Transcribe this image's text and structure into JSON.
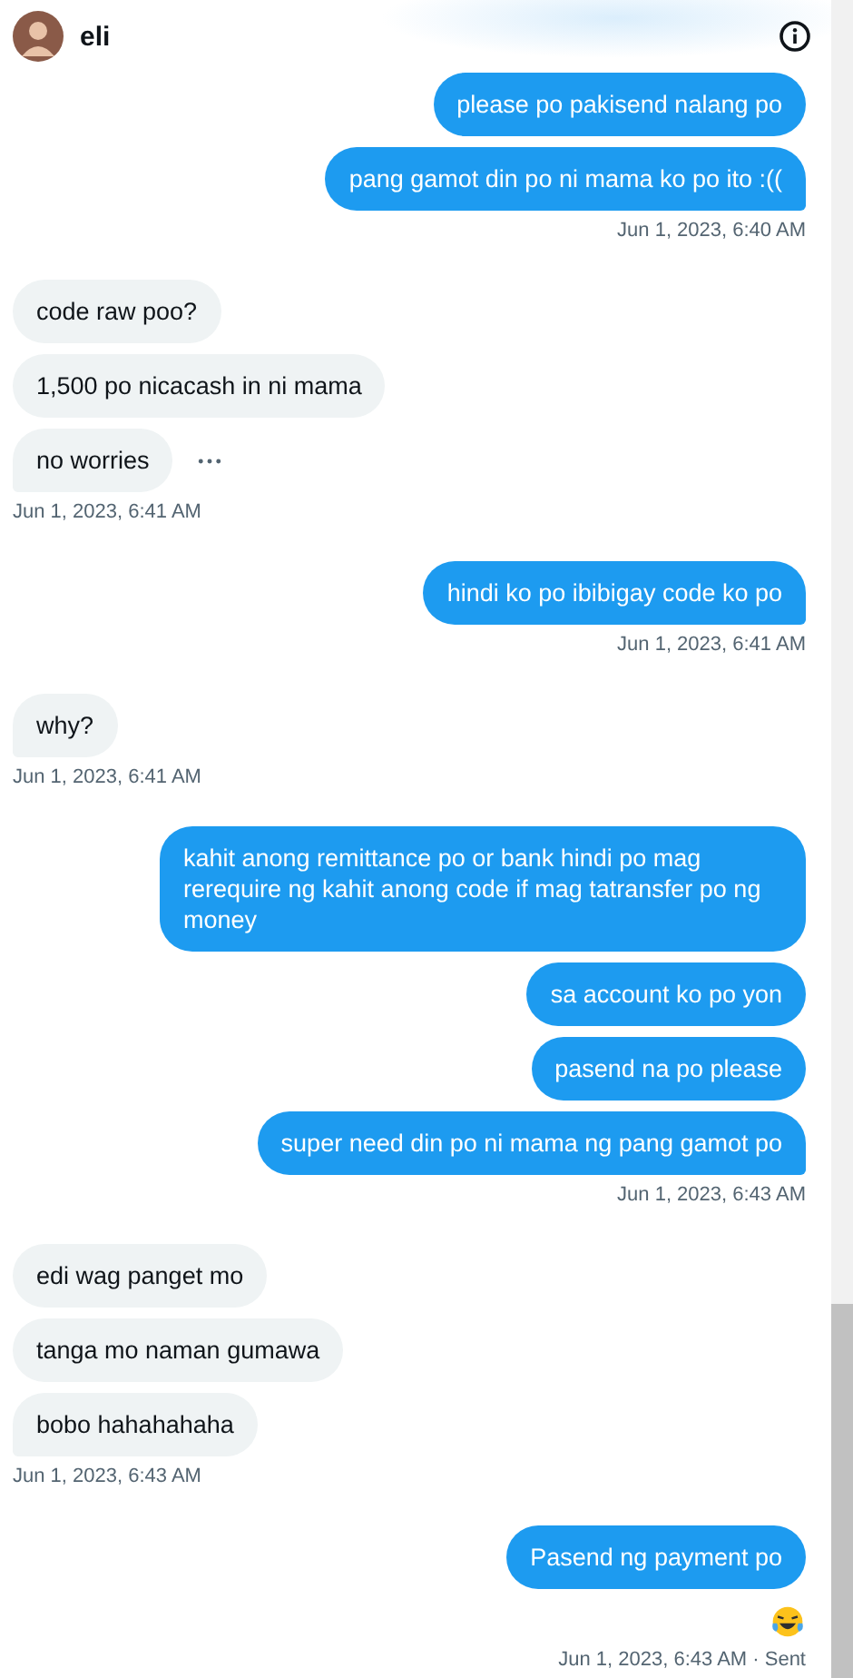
{
  "header": {
    "name": "eli"
  },
  "groups": [
    {
      "kind": "sent",
      "messages": [
        {
          "kind": "text",
          "text": "please po pakisend nalang po",
          "hovered": false
        },
        {
          "kind": "text",
          "text": "pang gamot din po ni mama ko po ito :((",
          "hovered": false
        }
      ],
      "time": "Jun 1, 2023, 6:40 AM"
    },
    {
      "kind": "received",
      "messages": [
        {
          "kind": "text",
          "text": "code raw poo?",
          "hovered": false
        },
        {
          "kind": "text",
          "text": "1,500 po nicacash in ni mama",
          "hovered": false
        },
        {
          "kind": "text",
          "text": "no worries",
          "hovered": true
        }
      ],
      "time": "Jun 1, 2023, 6:41 AM"
    },
    {
      "kind": "sent",
      "messages": [
        {
          "kind": "text",
          "text": "hindi ko po ibibigay code ko po",
          "hovered": false
        }
      ],
      "time": "Jun 1, 2023, 6:41 AM"
    },
    {
      "kind": "received",
      "messages": [
        {
          "kind": "text",
          "text": "why?",
          "hovered": false
        }
      ],
      "time": "Jun 1, 2023, 6:41 AM"
    },
    {
      "kind": "sent",
      "messages": [
        {
          "kind": "text",
          "text": "kahit anong remittance po or bank hindi po mag rerequire ng kahit anong code if mag tatransfer po ng money",
          "hovered": false
        },
        {
          "kind": "text",
          "text": "sa account ko po yon",
          "hovered": false
        },
        {
          "kind": "text",
          "text": "pasend na po please",
          "hovered": false
        },
        {
          "kind": "text",
          "text": "super need din po ni mama ng pang gamot po",
          "hovered": false
        }
      ],
      "time": "Jun 1, 2023, 6:43 AM"
    },
    {
      "kind": "received",
      "messages": [
        {
          "kind": "text",
          "text": "edi wag panget mo",
          "hovered": false
        },
        {
          "kind": "text",
          "text": "tanga mo naman gumawa",
          "hovered": false
        },
        {
          "kind": "text",
          "text": "bobo hahahahaha",
          "hovered": false
        }
      ],
      "time": "Jun 1, 2023, 6:43 AM"
    },
    {
      "kind": "sent",
      "messages": [
        {
          "kind": "text",
          "text": "Pasend ng payment po",
          "hovered": false
        },
        {
          "kind": "emoji",
          "hovered": false
        }
      ],
      "time": "Jun 1, 2023, 6:43 AM · Sent"
    }
  ]
}
